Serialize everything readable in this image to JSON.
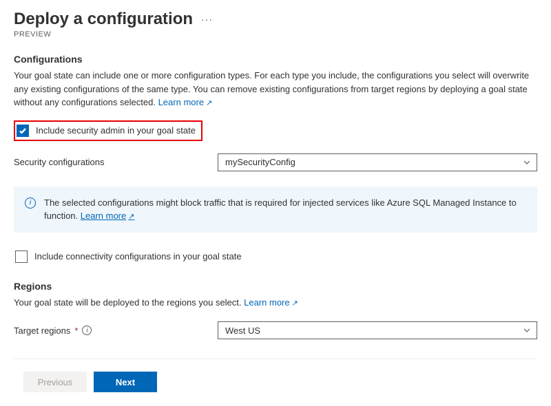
{
  "header": {
    "title": "Deploy a configuration",
    "preview": "PREVIEW"
  },
  "configurations": {
    "section_title": "Configurations",
    "description": "Your goal state can include one or more configuration types. For each type you include, the configurations you select will overwrite any existing configurations of the same type. You can remove existing configurations from target regions by deploying a goal state without any configurations selected. ",
    "learn_more": "Learn more",
    "include_security_label": "Include security admin in your goal state",
    "security_config_label": "Security configurations",
    "security_config_value": "mySecurityConfig",
    "info_banner": "The selected configurations might block traffic that is required for injected services like Azure SQL Managed Instance to function.  ",
    "info_banner_link": "Learn more",
    "include_connectivity_label": "Include connectivity configurations in your goal state"
  },
  "regions": {
    "section_title": "Regions",
    "description": "Your goal state will be deployed to the regions you select. ",
    "learn_more": "Learn more",
    "target_label": "Target regions",
    "target_value": "West US"
  },
  "footer": {
    "previous": "Previous",
    "next": "Next"
  }
}
